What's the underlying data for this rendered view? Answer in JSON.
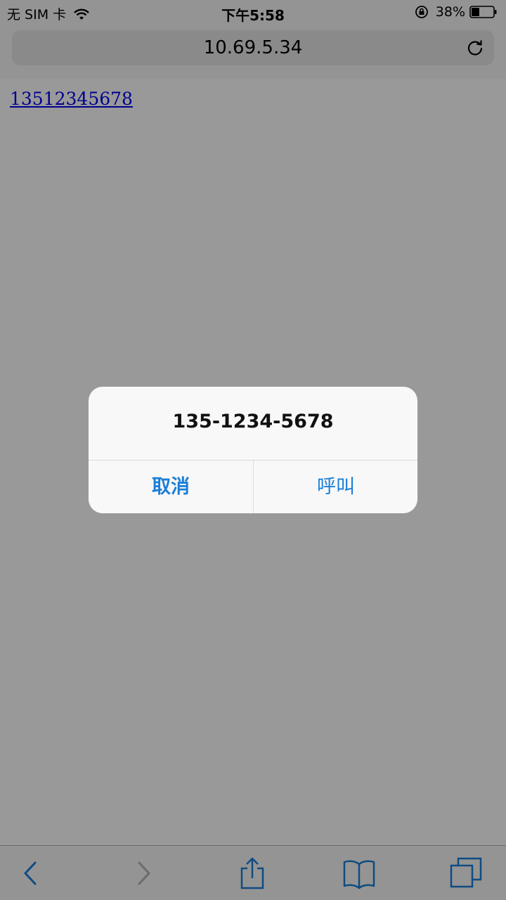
{
  "status_bar": {
    "carrier": "无 SIM 卡",
    "time": "下午5:58",
    "battery": "38%",
    "battery_level": 0.38
  },
  "address_bar": {
    "url": "10.69.5.34"
  },
  "page": {
    "phone_link": "13512345678"
  },
  "alert": {
    "title": "135-1234-5678",
    "cancel_label": "取消",
    "call_label": "呼叫"
  },
  "toolbar": {
    "icons": [
      "back-icon",
      "forward-icon",
      "share-icon",
      "bookmarks-icon",
      "tabs-icon"
    ]
  },
  "colors": {
    "accent": "#1a7ed9",
    "link": "#0000ee",
    "overlay": "rgba(0,0,0,0.4)"
  }
}
